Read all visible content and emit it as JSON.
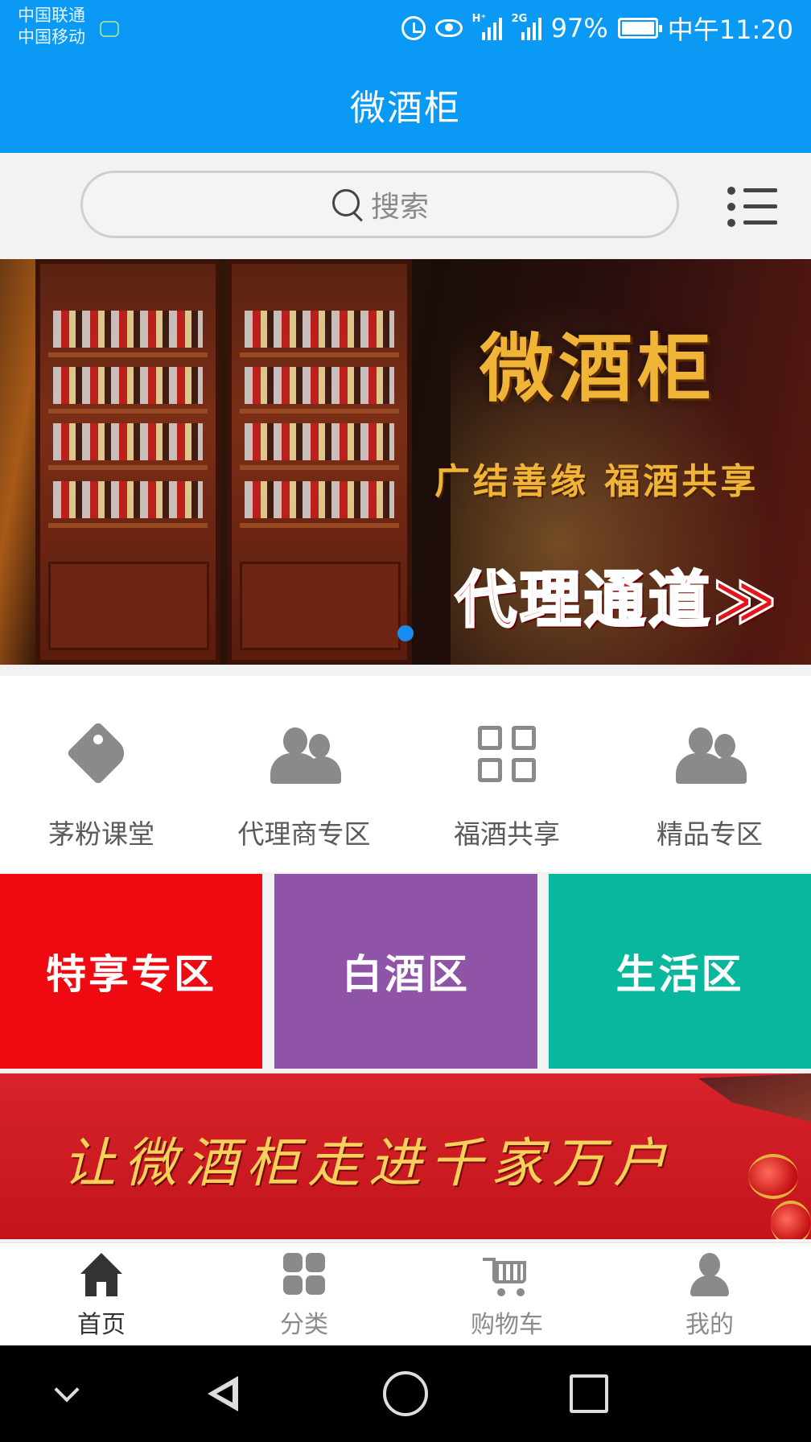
{
  "status_bar": {
    "carrier_1": "中国联通",
    "carrier_2": "中国移动",
    "battery_percent": "97%",
    "time": "中午11:20",
    "signal_1_label": "H⁺",
    "signal_2_label": "2G"
  },
  "header": {
    "title": "微酒柜"
  },
  "search": {
    "placeholder": "搜索"
  },
  "banner": {
    "title": "微酒柜",
    "slogan": "广结善缘 福酒共享",
    "cta": "代理通道≫"
  },
  "menu": {
    "items": [
      {
        "label": "茅粉课堂",
        "icon": "tag-icon"
      },
      {
        "label": "代理商专区",
        "icon": "users-icon"
      },
      {
        "label": "福酒共享",
        "icon": "grid-icon"
      },
      {
        "label": "精品专区",
        "icon": "users-icon"
      }
    ]
  },
  "tiles": [
    {
      "label": "特享专区",
      "color": "#ee0a10"
    },
    {
      "label": "白酒区",
      "color": "#8f53a8"
    },
    {
      "label": "生活区",
      "color": "#09b79d"
    }
  ],
  "promo": {
    "text": "让微酒柜走进千家万户"
  },
  "bottom_nav": {
    "items": [
      {
        "label": "首页",
        "icon": "home-icon",
        "active": true
      },
      {
        "label": "分类",
        "icon": "category-icon",
        "active": false
      },
      {
        "label": "购物车",
        "icon": "cart-icon",
        "active": false
      },
      {
        "label": "我的",
        "icon": "profile-icon",
        "active": false
      }
    ]
  },
  "colors": {
    "primary": "#0a99f5",
    "active_nav": "#333333",
    "inactive_nav": "#8a8a8a"
  }
}
